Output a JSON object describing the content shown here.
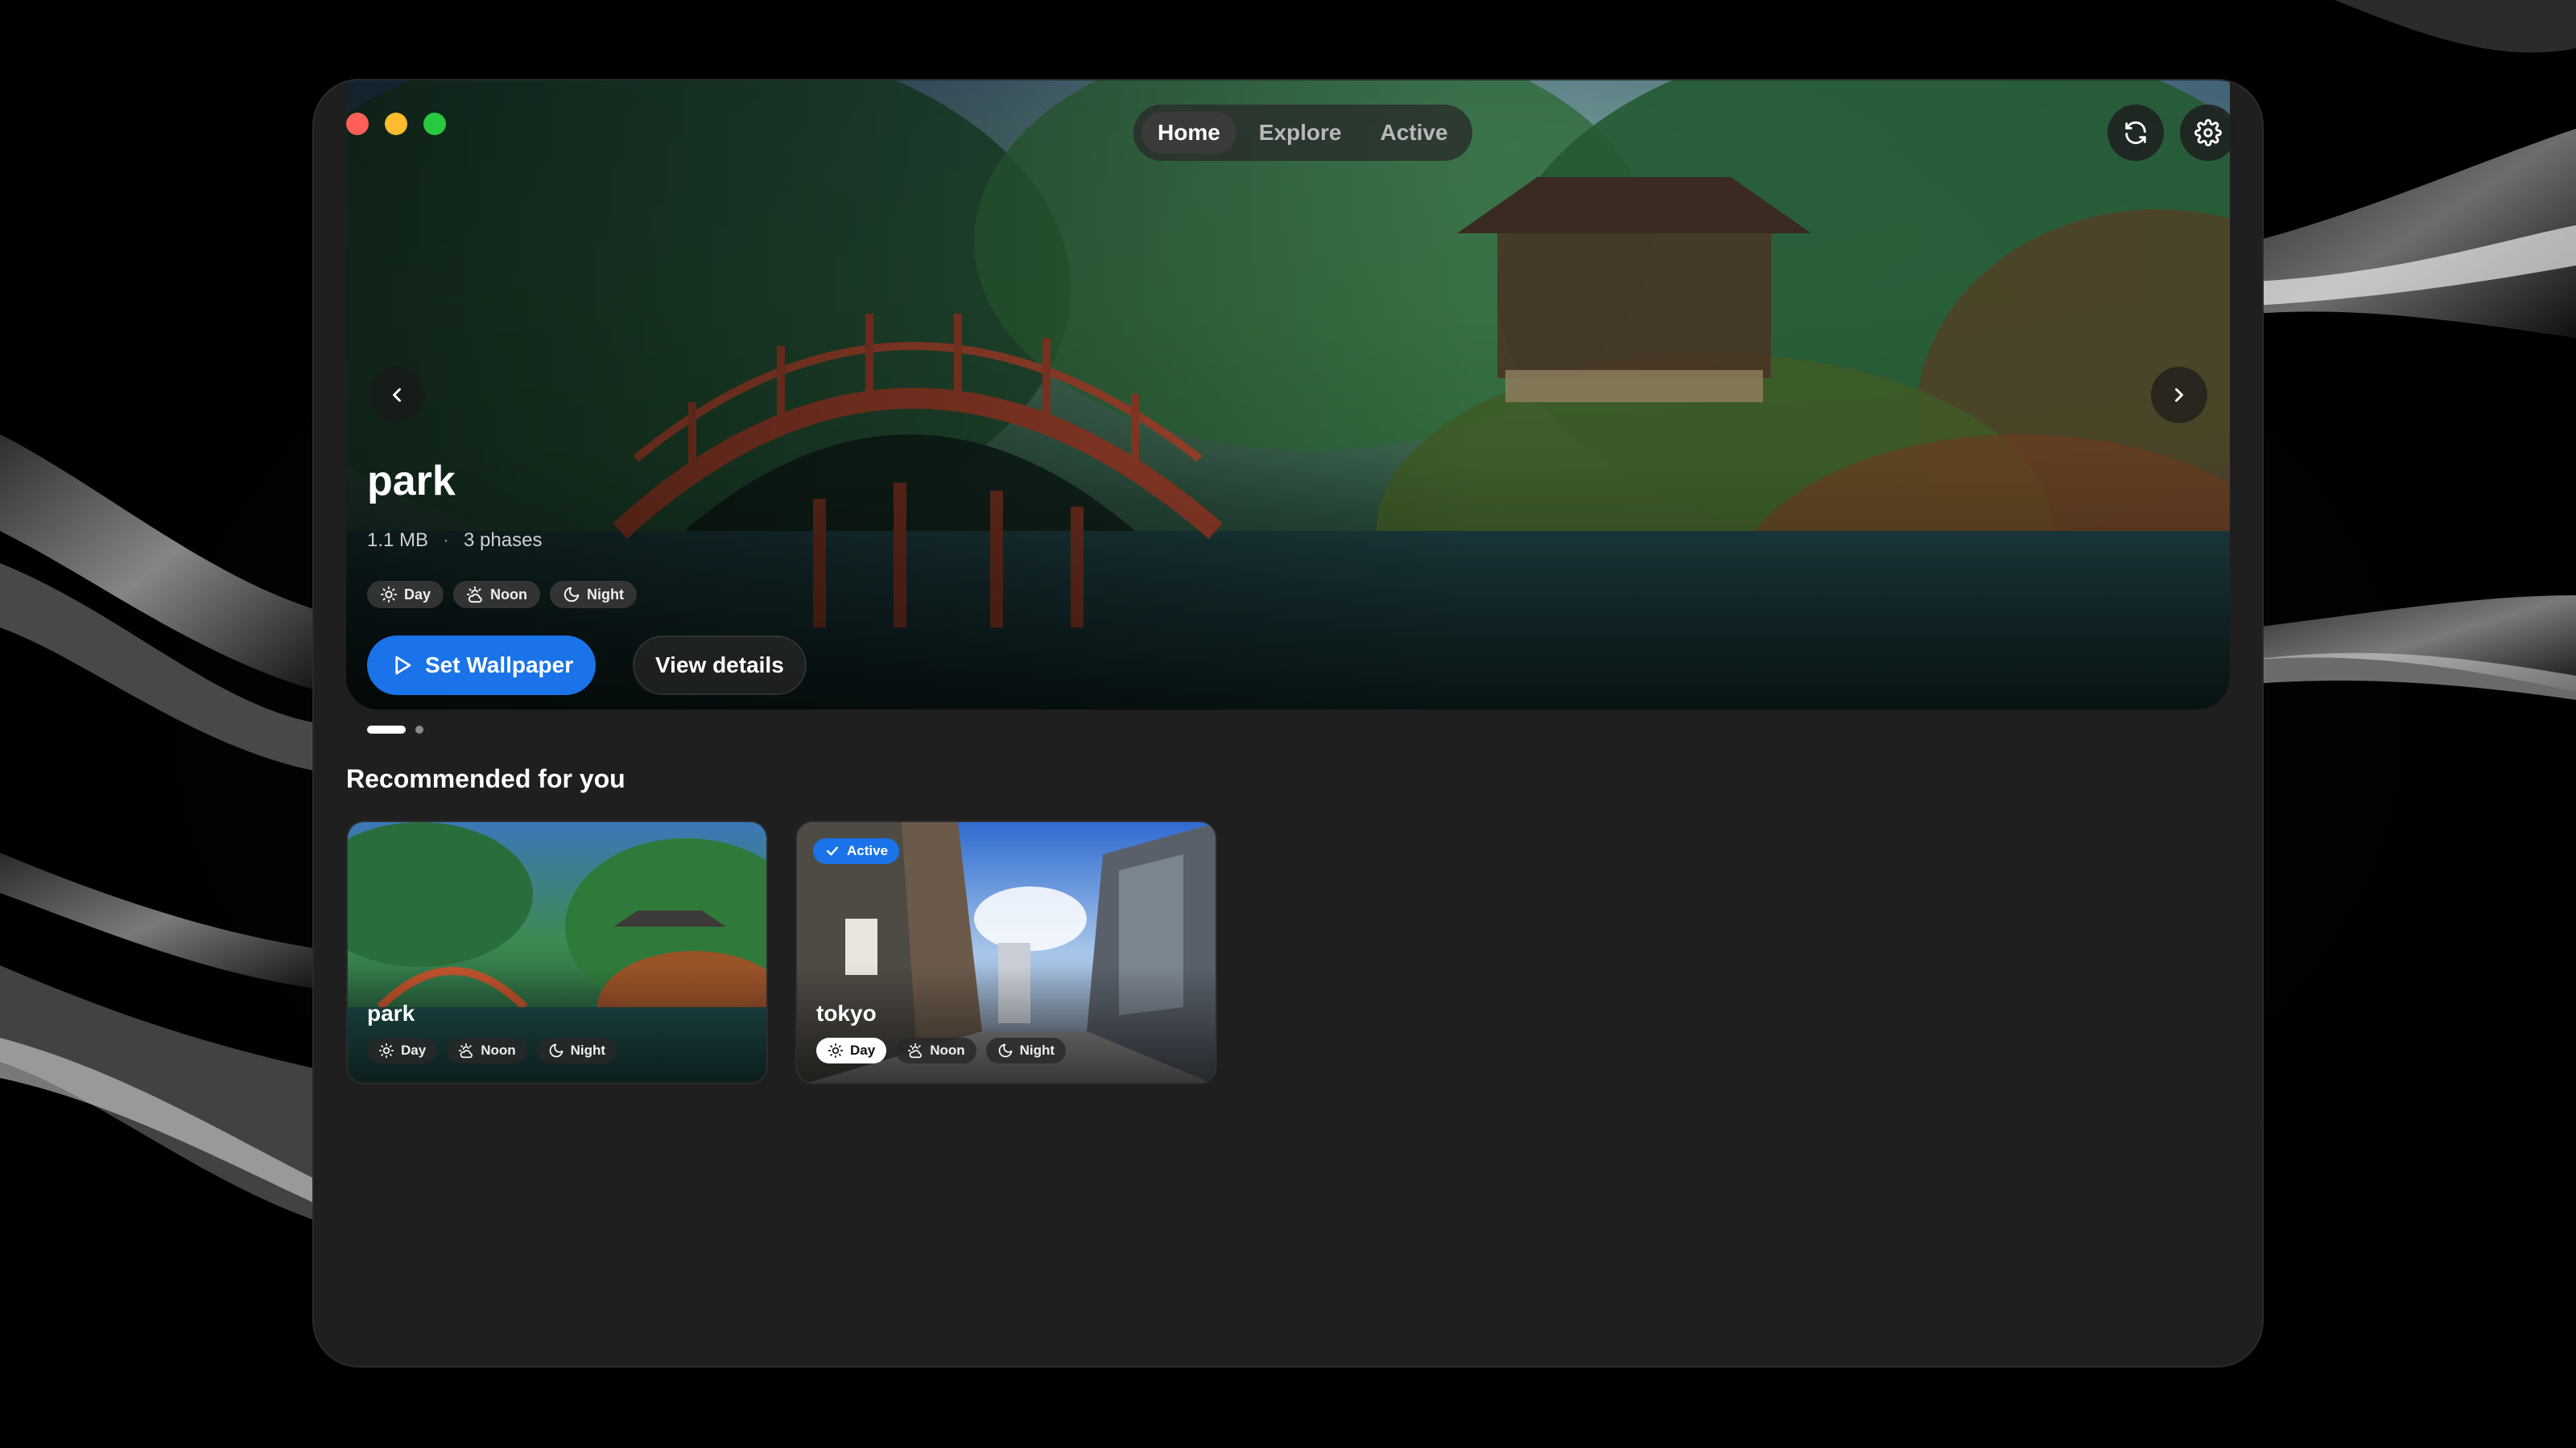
{
  "window": {
    "traffic_colors": [
      "#ff5f57",
      "#febc2e",
      "#28c840"
    ]
  },
  "nav": {
    "tabs": [
      {
        "label": "Home",
        "active": true
      },
      {
        "label": "Explore",
        "active": false
      },
      {
        "label": "Active",
        "active": false
      }
    ]
  },
  "toolbar": {
    "refresh_icon": "refresh-icon",
    "settings_icon": "gear-icon"
  },
  "hero": {
    "title": "park",
    "size": "1.1 MB",
    "separator": "·",
    "phases": "3 phases",
    "chips": [
      {
        "label": "Day",
        "icon": "sun-icon"
      },
      {
        "label": "Noon",
        "icon": "sun-cloud-icon"
      },
      {
        "label": "Night",
        "icon": "moon-icon"
      }
    ],
    "primary_label": "Set Wallpaper",
    "secondary_label": "View details",
    "slide_count": 2,
    "slide_index": 0
  },
  "recommended": {
    "title": "Recommended for you",
    "cards": [
      {
        "name": "park",
        "active": false,
        "chips": [
          {
            "label": "Day",
            "selected": false
          },
          {
            "label": "Noon",
            "selected": false
          },
          {
            "label": "Night",
            "selected": false
          }
        ]
      },
      {
        "name": "tokyo",
        "active": true,
        "badge": "Active",
        "chips": [
          {
            "label": "Day",
            "selected": true
          },
          {
            "label": "Noon",
            "selected": false
          },
          {
            "label": "Night",
            "selected": false
          }
        ]
      }
    ]
  },
  "colors": {
    "accent": "#1a73e8",
    "window_bg": "#1f1f1f"
  }
}
